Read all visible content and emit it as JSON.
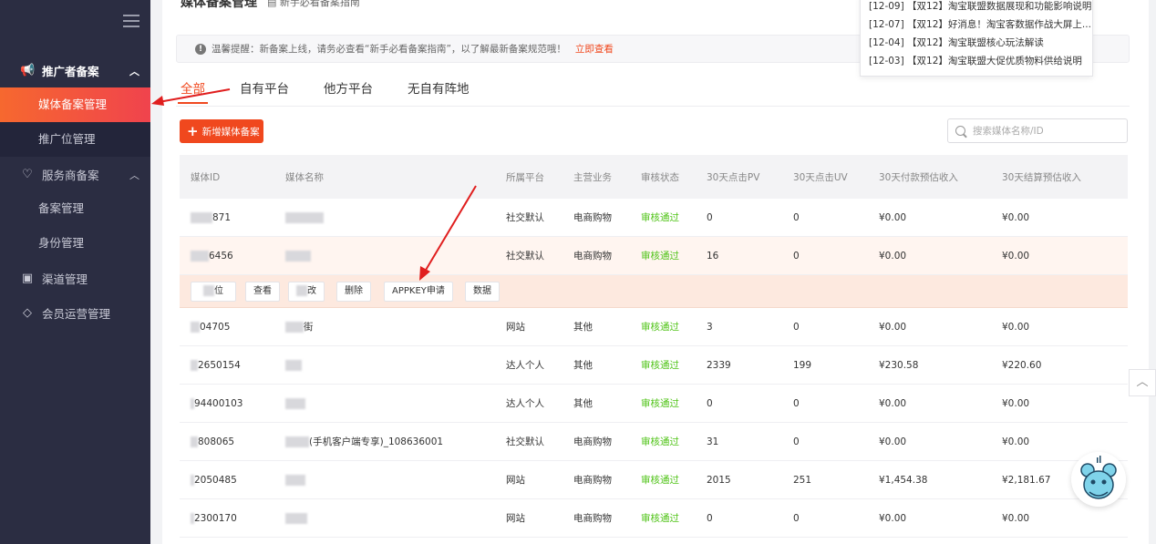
{
  "sidebar": {
    "groups": [
      {
        "label": "推广者备案",
        "icon": "megaphone-icon"
      },
      {
        "label": "服务商备案",
        "icon": "heart-shield-icon"
      },
      {
        "label": "渠道管理",
        "icon": "channel-icon"
      },
      {
        "label": "会员运营管理",
        "icon": "diamond-icon"
      }
    ],
    "subitems": {
      "media_record": "媒体备案管理",
      "promo_position": "推广位管理",
      "record_manage": "备案管理",
      "identity_manage": "身份管理"
    }
  },
  "header": {
    "title": "媒体备案管理",
    "guide": "新手必看备案指南"
  },
  "notice": {
    "text": "温馨提醒：新备案上线，请务必查看“新手必看备案指南”，以了解最新备案规范哦！",
    "link": "立即查看"
  },
  "news": [
    "[12-09] 【双12】淘宝联盟数据展现和功能影响说明",
    "[12-07] 【双12】好消息！淘宝客数据作战大屏上...",
    "[12-04] 【双12】淘宝联盟核心玩法解读",
    "[12-03] 【双12】淘宝联盟大促优质物料供给说明"
  ],
  "tabs": [
    "全部",
    "自有平台",
    "他方平台",
    "无自有阵地"
  ],
  "add_button": "新增媒体备案",
  "search": {
    "placeholder": "搜索媒体名称/ID"
  },
  "table": {
    "headers": [
      "媒体ID",
      "媒体名称",
      "所属平台",
      "主营业务",
      "审核状态",
      "30天点击PV",
      "30天点击UV",
      "30天付款预估收入",
      "30天结算预估收入"
    ],
    "rows": [
      {
        "id": "871",
        "name": "",
        "platform": "社交默认",
        "business": "电商购物",
        "status": "审核通过",
        "pv": "0",
        "uv": "0",
        "pay": "¥0.00",
        "settle": "¥0.00"
      },
      {
        "id": "6456",
        "name": "",
        "platform": "社交默认",
        "business": "电商购物",
        "status": "审核通过",
        "pv": "16",
        "uv": "0",
        "pay": "¥0.00",
        "settle": "¥0.00"
      },
      {
        "id": "04705",
        "name": "街",
        "platform": "网站",
        "business": "其他",
        "status": "审核通过",
        "pv": "3",
        "uv": "0",
        "pay": "¥0.00",
        "settle": "¥0.00"
      },
      {
        "id": "2650154",
        "name": "",
        "platform": "达人个人",
        "business": "其他",
        "status": "审核通过",
        "pv": "2339",
        "uv": "199",
        "pay": "¥230.58",
        "settle": "¥220.60"
      },
      {
        "id": "94400103",
        "name": "",
        "platform": "达人个人",
        "business": "其他",
        "status": "审核通过",
        "pv": "0",
        "uv": "0",
        "pay": "¥0.00",
        "settle": "¥0.00"
      },
      {
        "id": "808065",
        "name": "(手机客户端专享)_108636001",
        "platform": "社交默认",
        "business": "电商购物",
        "status": "审核通过",
        "pv": "31",
        "uv": "0",
        "pay": "¥0.00",
        "settle": "¥0.00"
      },
      {
        "id": "2050485",
        "name": "",
        "platform": "网站",
        "business": "电商购物",
        "status": "审核通过",
        "pv": "2015",
        "uv": "251",
        "pay": "¥1,454.38",
        "settle": "¥2,181.67"
      },
      {
        "id": "2300170",
        "name": "",
        "platform": "网站",
        "business": "电商购物",
        "status": "审核通过",
        "pv": "0",
        "uv": "0",
        "pay": "¥0.00",
        "settle": "¥0.00"
      }
    ],
    "actions": [
      "位",
      "查看",
      "改",
      "删除",
      "APPKEY申请",
      "数据"
    ]
  },
  "colors": {
    "accent": "#f0481e",
    "sidebar": "#2b2d42",
    "success": "#52c41a"
  }
}
